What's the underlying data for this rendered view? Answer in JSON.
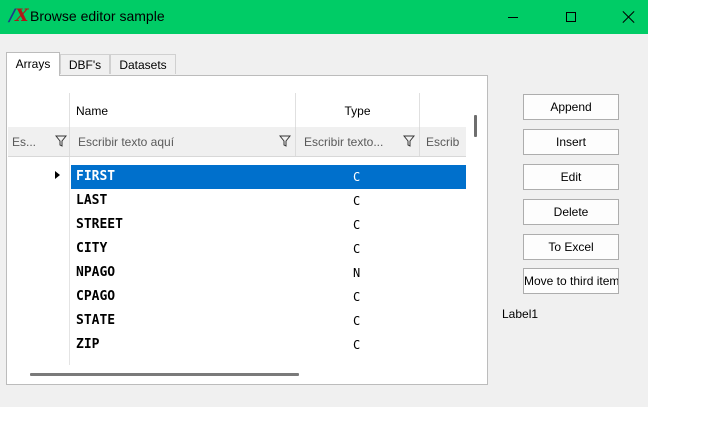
{
  "window": {
    "title": "Browse editor sample",
    "accent_color": "#00cc66",
    "icon_text": "X"
  },
  "tabs": [
    {
      "label": "Arrays",
      "active": true
    },
    {
      "label": "DBF's",
      "active": false
    },
    {
      "label": "Datasets",
      "active": false
    }
  ],
  "grid": {
    "columns": [
      {
        "header": "Name"
      },
      {
        "header": "Type"
      }
    ],
    "filters": {
      "indicator": "Es...",
      "name": "Escribir texto aquí",
      "type": "Escribir texto...",
      "extra": "Escrib"
    },
    "rows": [
      {
        "name": "FIRST",
        "type": "C",
        "selected": true
      },
      {
        "name": "LAST",
        "type": "C"
      },
      {
        "name": "STREET",
        "type": "C"
      },
      {
        "name": "CITY",
        "type": "C"
      },
      {
        "name": "NPAGO",
        "type": "N"
      },
      {
        "name": "CPAGO",
        "type": "C"
      },
      {
        "name": "STATE",
        "type": "C"
      },
      {
        "name": "ZIP",
        "type": "C"
      }
    ],
    "selection_color": "#0070cc"
  },
  "buttons": {
    "append": "Append",
    "insert": "Insert",
    "edit": "Edit",
    "delete": "Delete",
    "to_excel": "To Excel",
    "move_third": "Move to third item"
  },
  "label1": "Label1"
}
